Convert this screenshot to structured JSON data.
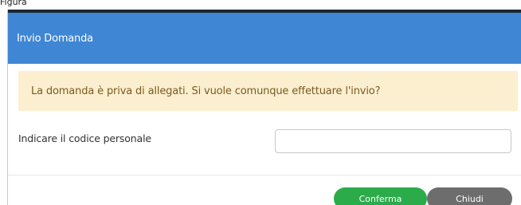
{
  "page": {
    "top_label": "Figura"
  },
  "dialog": {
    "title": "Invio Domanda",
    "alert_message": "La domanda è priva di allegati. Si vuole comunque effettuare l'invio?",
    "field_label": "Indicare il codice personale",
    "field_value": "",
    "field_placeholder": "",
    "confirm_label": "Conferma",
    "close_label": "Chiudi"
  },
  "colors": {
    "header": "#3f86d4",
    "alert_background": "#fcefd0",
    "confirm_button": "#2bab4a",
    "close_button": "#6d6d6d"
  }
}
